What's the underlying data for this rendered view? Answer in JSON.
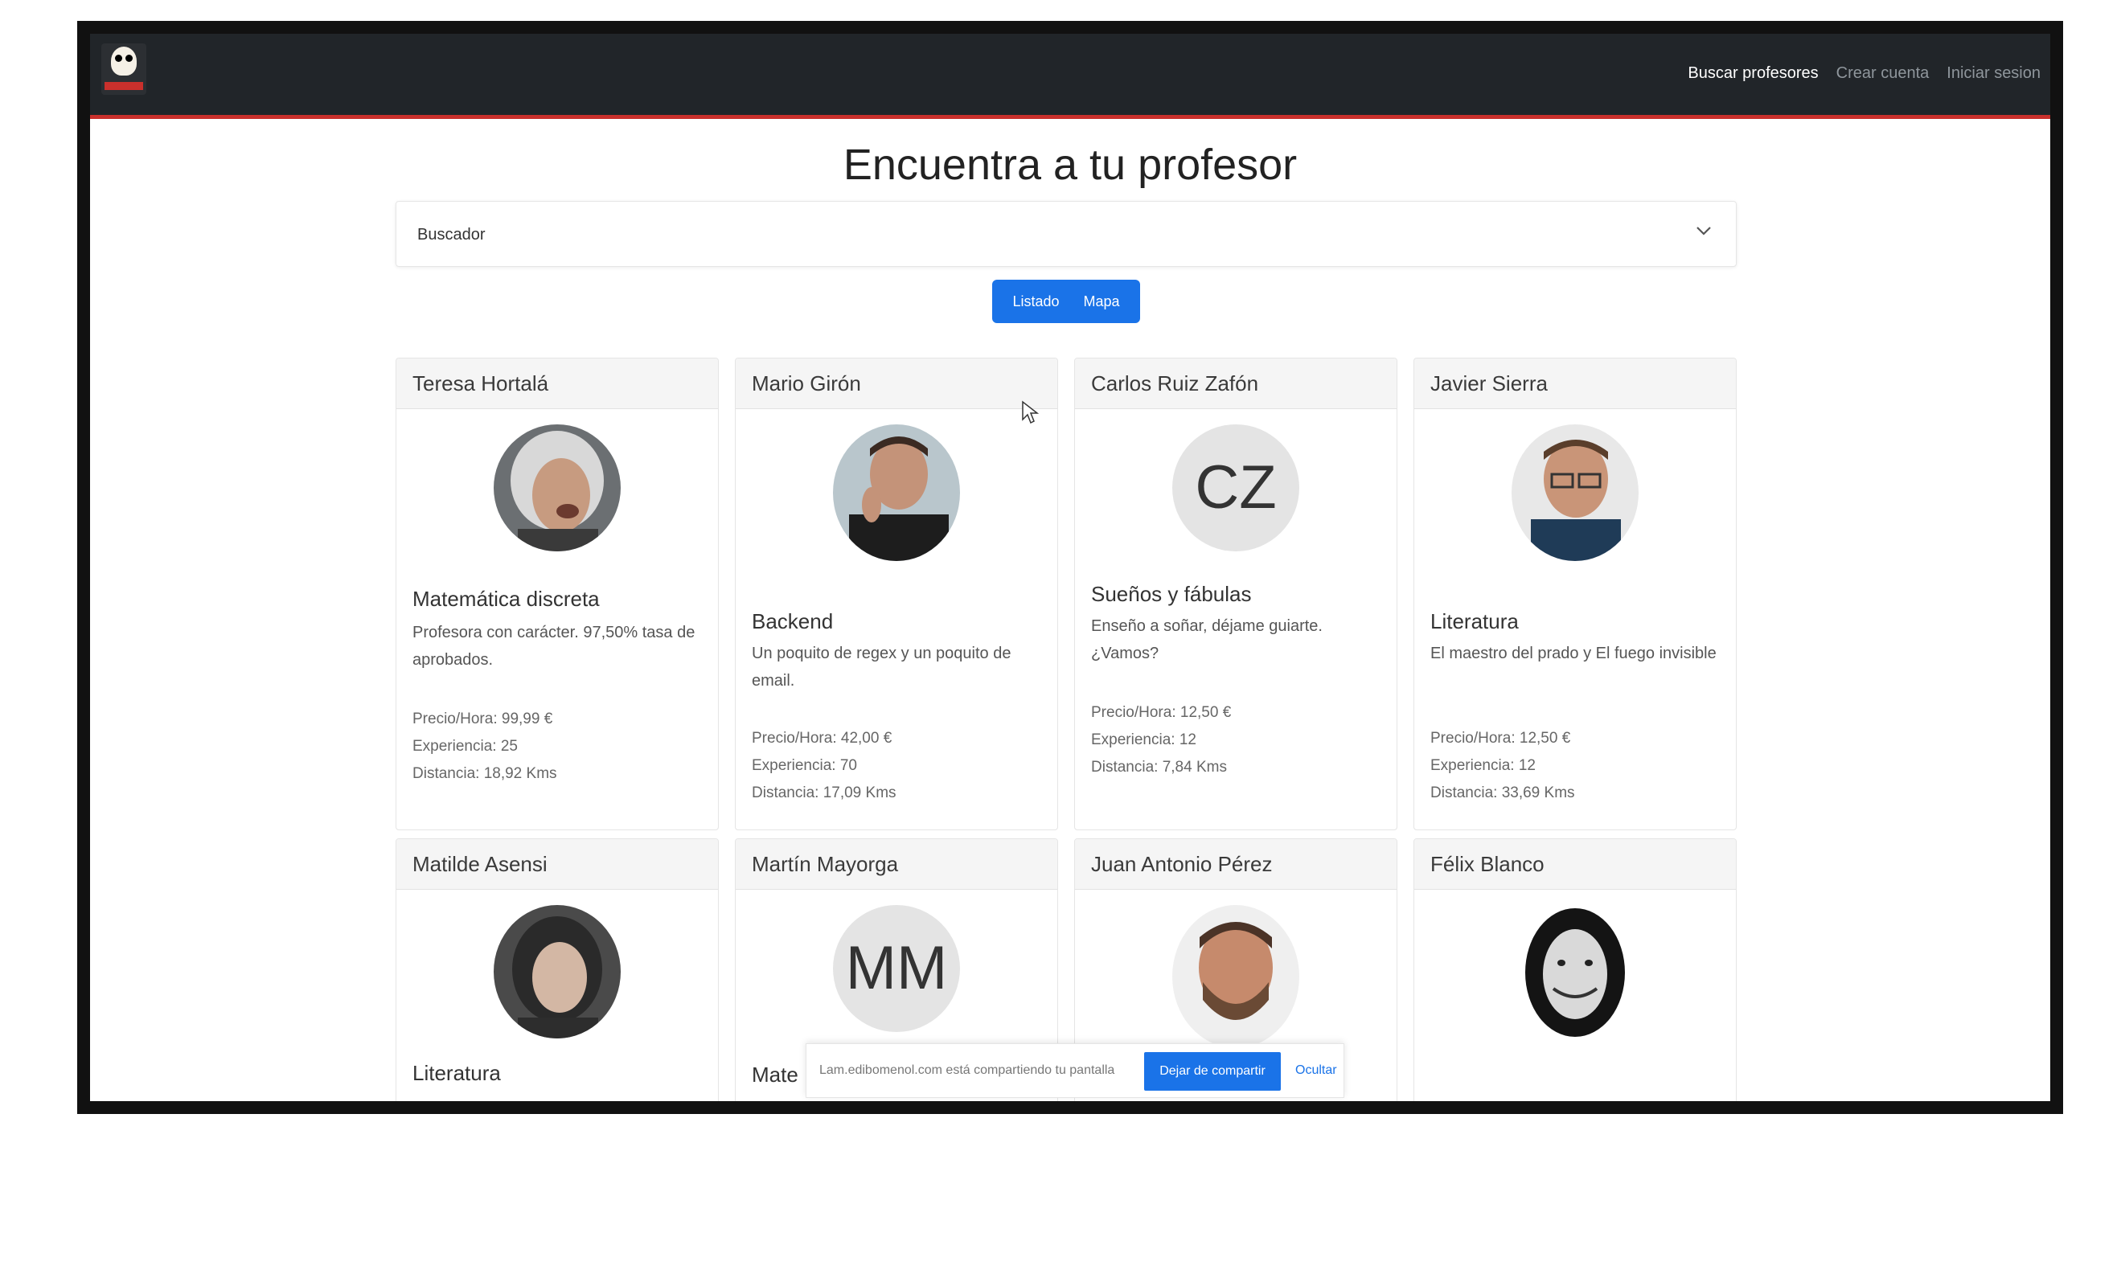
{
  "navbar": {
    "links": [
      "Buscar profesores",
      "Crear cuenta",
      "Iniciar sesion"
    ]
  },
  "page": {
    "title": "Encuentra a tu profesor"
  },
  "search": {
    "label": "Buscador"
  },
  "view_toggle": {
    "list_label": "Listado",
    "map_label": "Mapa"
  },
  "teachers": [
    {
      "name": "Teresa Hortalá",
      "subject": "Matemática discreta",
      "description": "Profesora con carácter. 97,50% tasa de aprobados.",
      "price": "Precio/Hora: 99,99 €",
      "experience": "Experiencia: 25",
      "distance": "Distancia: 18,92 Kms",
      "photo": "photo-woman-smiling"
    },
    {
      "name": "Mario Girón",
      "subject": "Backend",
      "description": "Un poquito de regex y un poquito de email.",
      "price": "Precio/Hora: 42,00 €",
      "experience": "Experiencia: 70",
      "distance": "Distancia: 17,09 Kms",
      "photo": "photo-man-gesturing"
    },
    {
      "name": "Carlos Ruiz Zafón",
      "subject": "Sueños y fábulas",
      "description": "Enseño a soñar, déjame guiarte. ¿Vamos?",
      "price": "Precio/Hora: 12,50 €",
      "experience": "Experiencia: 12",
      "distance": "Distancia: 7,84 Kms",
      "initials": "CZ"
    },
    {
      "name": "Javier Sierra",
      "subject": "Literatura",
      "description": "El maestro del prado y El fuego invisible",
      "price": "Precio/Hora: 12,50 €",
      "experience": "Experiencia: 12",
      "distance": "Distancia: 33,69 Kms",
      "photo": "photo-man-glasses"
    },
    {
      "name": "Matilde Asensi",
      "subject": "Literatura",
      "photo": "photo-woman-portrait"
    },
    {
      "name": "Martín Mayorga",
      "subject": "Mate",
      "initials": "MM"
    },
    {
      "name": "Juan Antonio Pérez",
      "photo": "photo-man-beard"
    },
    {
      "name": "Félix Blanco",
      "photo": "photo-man-bw"
    }
  ],
  "cookie_bar": {
    "text": "Lam.edibomenol.com está compartiendo tu pantalla",
    "accept_label": "Dejar de compartir",
    "hide_label": "Ocultar"
  },
  "colors": {
    "navbar": "#212529",
    "accent_red": "#c9302c",
    "primary_blue": "#1a73e8"
  }
}
